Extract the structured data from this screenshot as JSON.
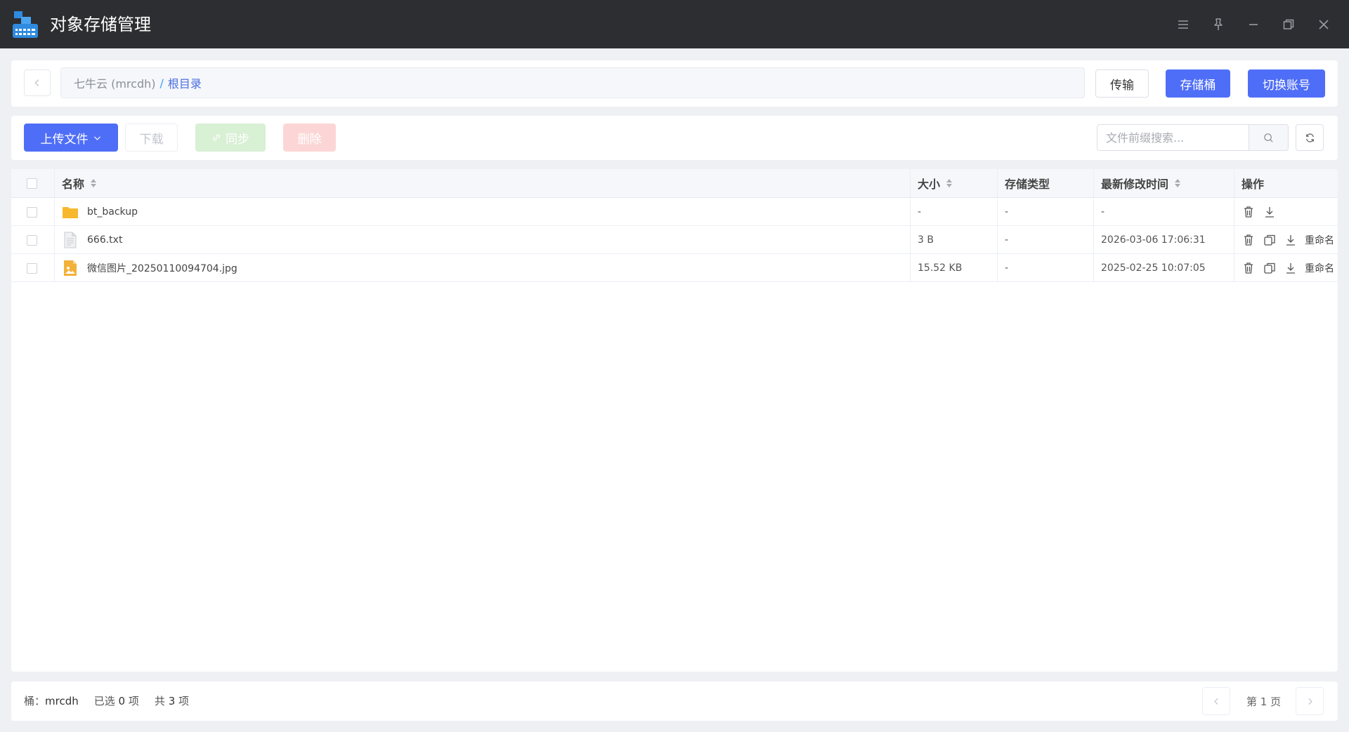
{
  "window": {
    "title": "对象存储管理"
  },
  "nav": {
    "breadcrumb_root": "七牛云 (mrcdh)",
    "breadcrumb_sep": "/",
    "breadcrumb_current": "根目录",
    "transfer_label": "传输",
    "bucket_label": "存储桶",
    "switch_account_label": "切换账号"
  },
  "toolbar": {
    "upload_label": "上传文件",
    "download_label": "下载",
    "sync_label": "同步",
    "delete_label": "删除",
    "search_placeholder": "文件前缀搜索..."
  },
  "table": {
    "columns": {
      "name": "名称",
      "size": "大小",
      "storage_type": "存储类型",
      "modified": "最新修改时间",
      "actions": "操作"
    },
    "rows": [
      {
        "name": "bt_backup",
        "type": "folder",
        "size": "-",
        "storage_type": "-",
        "modified": "-"
      },
      {
        "name": "666.txt",
        "type": "text",
        "size": "3 B",
        "storage_type": "-",
        "modified": "2026-03-06 17:06:31",
        "rename_label": "重命名"
      },
      {
        "name": "微信图片_20250110094704.jpg",
        "type": "image",
        "size": "15.52 KB",
        "storage_type": "-",
        "modified": "2025-02-25 10:07:05",
        "rename_label": "重命名"
      }
    ]
  },
  "footer": {
    "bucket_label": "桶：",
    "bucket_value": "mrcdh",
    "selected_prefix": "已选",
    "selected_count": "0",
    "selected_suffix": "项",
    "total_prefix": "共",
    "total_count": "3",
    "total_suffix": "项",
    "page_text": "第 1 页"
  },
  "colors": {
    "accent": "#4f6ef7",
    "titlebar": "#2d2e32",
    "folder": "#f7b82e"
  }
}
